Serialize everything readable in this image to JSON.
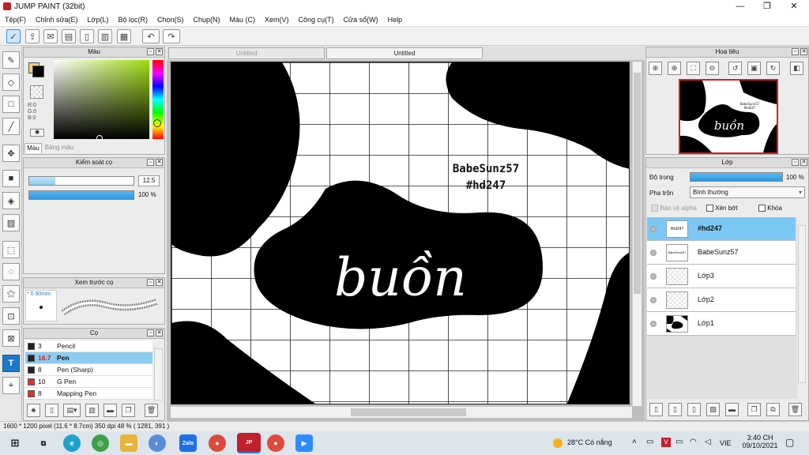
{
  "window": {
    "title": "JUMP PAINT (32bit)",
    "minimize": "—",
    "maximize": "❐",
    "close": "✕"
  },
  "menu": [
    "Tệp(F)",
    "Chỉnh sửa(E)",
    "Lớp(L)",
    "Bộ lọc(R)",
    "Chọn(S)",
    "Chụp(N)",
    "Màu (C)",
    "Xem(V)",
    "Công cụ(T)",
    "Cửa sổ(W)",
    "Help"
  ],
  "color_panel": {
    "title": "Màu",
    "r": "R:0",
    "g": "G:0",
    "b": "B:0",
    "tab1": "Màu",
    "tab2": "Bảng màu",
    "fg_color": "#000000",
    "bg_color": "#f5d070"
  },
  "brush_control": {
    "title": "Kiểm soát cọ",
    "size": "12.5",
    "opacity": "100 %",
    "size_fraction": 0.25,
    "opacity_fraction": 1.0
  },
  "brush_preview": {
    "title": "Xem trước cọ",
    "size": "* 0.90mm"
  },
  "brushes": {
    "title": "Cọ",
    "items": [
      {
        "size": "3",
        "name": "Pencil",
        "color": "#222222",
        "selected": false
      },
      {
        "size": "16.7",
        "name": "Pen",
        "color": "#222222",
        "selected": true
      },
      {
        "size": "8",
        "name": "Pen (Sharp)",
        "color": "#222222",
        "selected": false
      },
      {
        "size": "10",
        "name": "G Pen",
        "color": "#e03030",
        "selected": false
      },
      {
        "size": "8",
        "name": "Mapping Pen",
        "color": "#e03030",
        "selected": false
      }
    ]
  },
  "canvas": {
    "tab1": "Untitled",
    "tab2": "Untitled",
    "text_big": "buồn",
    "text_small1": "BabeSunz57",
    "text_small2": "#hd247"
  },
  "navigator": {
    "title": "Hoa tiêu",
    "mini_text": "buồn",
    "mini_small": "BabeSunz57\n#hd247"
  },
  "layers": {
    "title": "Lớp",
    "opacity_label": "Độ trong",
    "opacity_value": "100 %",
    "opacity_fraction": 1.0,
    "blend_label": "Pha trộn",
    "blend_value": "Bình thường",
    "protect_alpha": "Bảo vệ alpha",
    "clipping": "Xén bớt",
    "lock": "Khóa",
    "items": [
      {
        "name": "#hd247",
        "selected": true,
        "thumb_text": "#hd247"
      },
      {
        "name": "BabeSunz57",
        "selected": false,
        "thumb_text": "BabeSunz57"
      },
      {
        "name": "Lớp3",
        "selected": false
      },
      {
        "name": "Lớp2",
        "selected": false
      },
      {
        "name": "Lớp1",
        "selected": false
      }
    ]
  },
  "status": "1600 * 1200 pixel  (11.6 * 8.7cm)  350 dpi  48 %  ( 1281, 391 )",
  "taskbar": {
    "weather": "28°C  Có nắng",
    "lang": "VIE",
    "time": "3:40 CH",
    "date": "09/10/2021",
    "zalo": "Zalo"
  }
}
